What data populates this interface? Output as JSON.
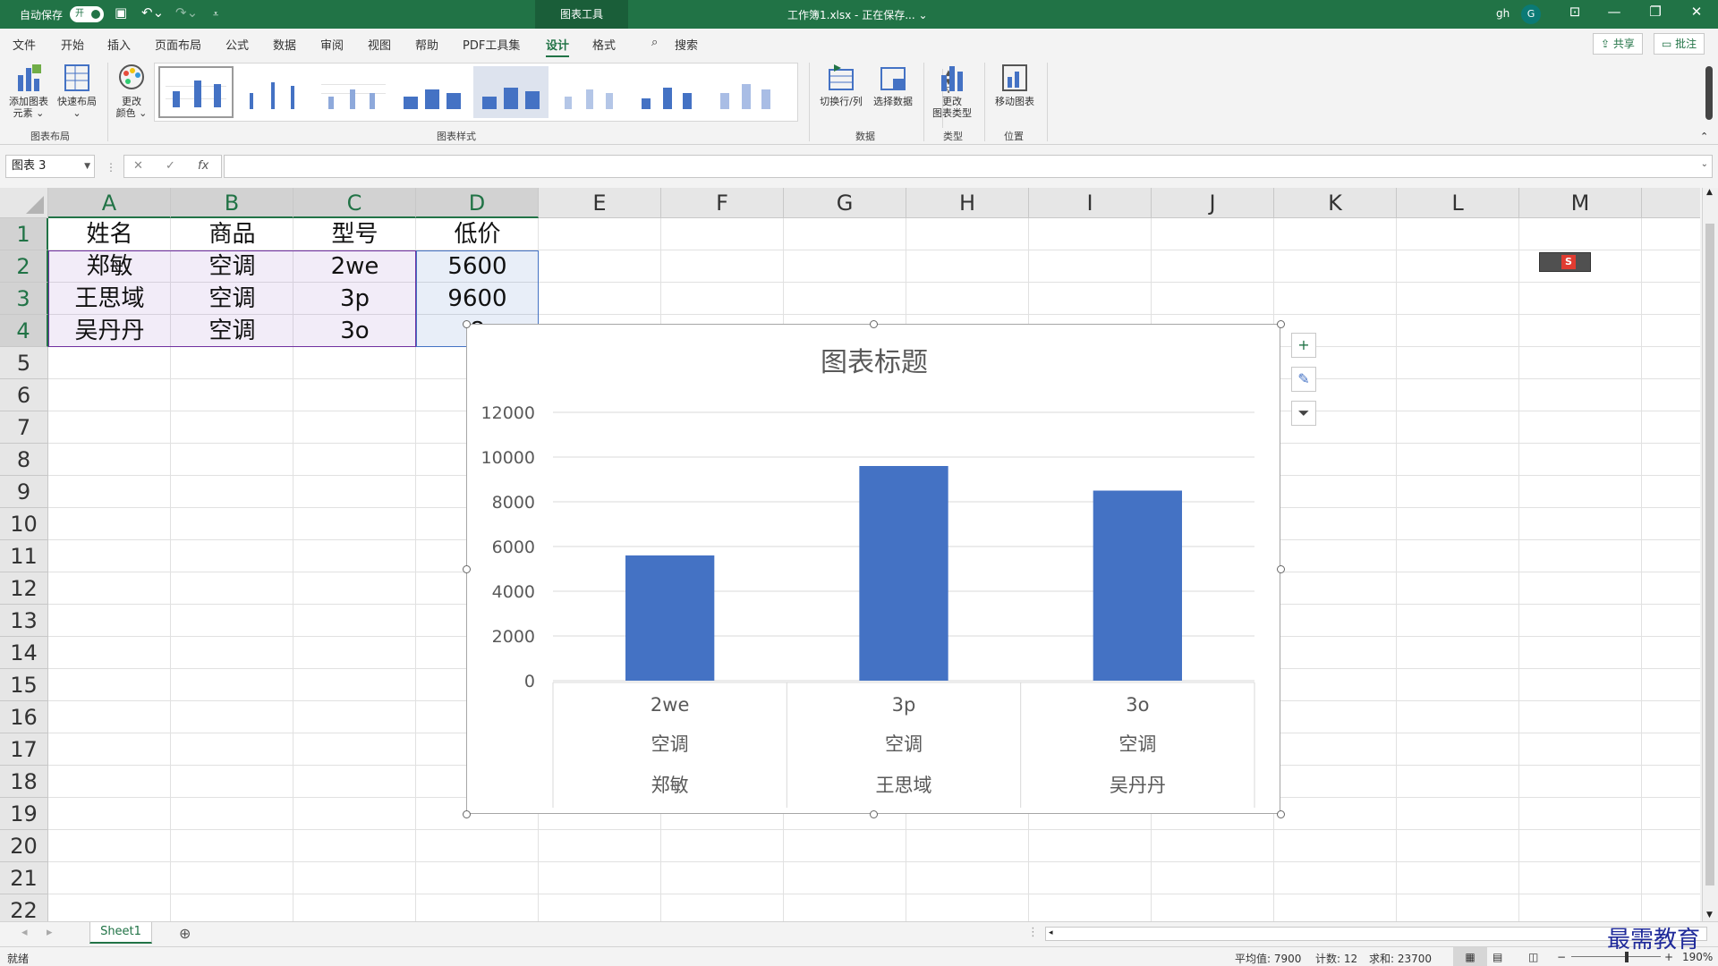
{
  "titlebar": {
    "autosave_label": "自动保存",
    "autosave_state": "开",
    "tool_tab": "图表工具",
    "doc_title": "工作簿1.xlsx - 正在保存... ⌄",
    "user": "gh",
    "avatar_initial": "G"
  },
  "menu": {
    "tabs": [
      "文件",
      "开始",
      "插入",
      "页面布局",
      "公式",
      "数据",
      "审阅",
      "视图",
      "帮助",
      "PDF工具集",
      "设计",
      "格式"
    ],
    "search": "搜索",
    "share": "共享",
    "comment": "批注"
  },
  "ribbon": {
    "add_element": "添加图表\n元素 ⌄",
    "quick_layout": "快速布局\n⌄",
    "change_color": "更改\n颜色 ⌄",
    "group_layout": "图表布局",
    "group_styles": "图表样式",
    "switch_rowcol": "切换行/列",
    "select_data": "选择数据",
    "group_data": "数据",
    "change_type": "更改\n图表类型",
    "group_type": "类型",
    "move_chart": "移动图表",
    "group_location": "位置"
  },
  "formula_bar": {
    "name_box": "图表 3",
    "cancel": "✕",
    "enter": "✓",
    "fx": "fx",
    "value": ""
  },
  "grid": {
    "columns": [
      "A",
      "B",
      "C",
      "D",
      "E",
      "F",
      "G",
      "H",
      "I",
      "J",
      "K",
      "L",
      "M",
      "I"
    ],
    "rows": [
      "1",
      "2",
      "3",
      "4",
      "5",
      "6",
      "7",
      "8",
      "9",
      "10",
      "11",
      "12",
      "13",
      "14",
      "15",
      "16",
      "17",
      "18",
      "19",
      "20",
      "21",
      "22"
    ],
    "cells": [
      [
        "姓名",
        "商品",
        "型号",
        "低价"
      ],
      [
        "郑敏",
        "空调",
        "2we",
        "5600"
      ],
      [
        "王思域",
        "空调",
        "3p",
        "9600"
      ],
      [
        "吴丹丹",
        "空调",
        "3o",
        "8"
      ]
    ]
  },
  "chart_data": {
    "type": "bar",
    "title": "图表标题",
    "categories": [
      [
        "2we",
        "空调",
        "郑敏"
      ],
      [
        "3p",
        "空调",
        "王思域"
      ],
      [
        "3o",
        "空调",
        "吴丹丹"
      ]
    ],
    "values": [
      5600,
      9600,
      8500
    ],
    "ylim": [
      0,
      12000
    ],
    "yticks": [
      "0",
      "2000",
      "4000",
      "6000",
      "8000",
      "10000",
      "12000"
    ],
    "bar_color": "#4472c4",
    "grid": true
  },
  "sheets": {
    "active": "Sheet1",
    "add": "⊕"
  },
  "status": {
    "ready": "就绪",
    "average": "平均值: 7900",
    "count": "计数: 12",
    "sum": "求和: 23700",
    "zoom": "190%"
  },
  "watermark": "最需教育",
  "colors": {
    "excel_green": "#217346",
    "bar_blue": "#4472c4"
  }
}
